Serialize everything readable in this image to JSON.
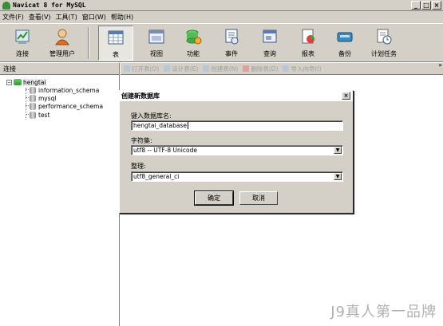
{
  "window": {
    "title": "Navicat 8 for MySQL",
    "min": "_",
    "max": "□",
    "close": "×"
  },
  "menu": [
    "文件(F)",
    "查看(V)",
    "工具(T)",
    "窗口(W)",
    "帮助(H)"
  ],
  "toolbar": {
    "buttons": [
      "连接",
      "管理用户",
      "表",
      "视图",
      "功能",
      "事件",
      "查询",
      "报表",
      "备份",
      "计划任务"
    ],
    "active": "表",
    "chevron": "»"
  },
  "left": {
    "header": "连接",
    "connection": "hengtai",
    "databases": [
      "information_schema",
      "mysql",
      "performance_schema",
      "test"
    ]
  },
  "subtoolbar": [
    "打开表(O)",
    "设计表(E)",
    "创建表(N)",
    "删除表(D)",
    "导入向导(I)"
  ],
  "dialog": {
    "title": "创建新数据库",
    "close": "×",
    "name_label": "键入数据库名:",
    "name_value": "hengtai_database",
    "charset_label": "字符集:",
    "charset_value": "utf8 -- UTF-8 Unicode",
    "collation_label": "整理:",
    "collation_value": "utf8_general_ci",
    "ok": "确定",
    "cancel": "取消",
    "dropdown_arrow": "▼"
  },
  "watermark": "J9真人第一品牌"
}
